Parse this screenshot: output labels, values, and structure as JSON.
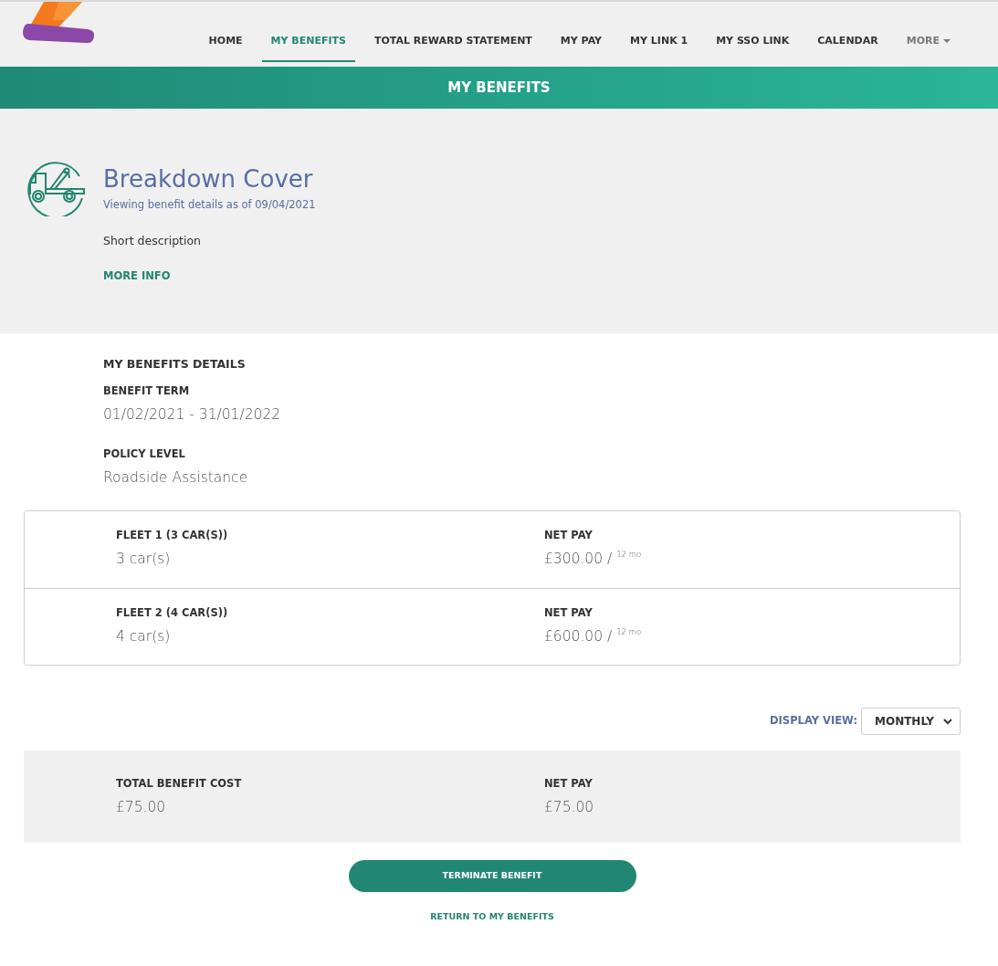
{
  "header": {
    "nav": [
      {
        "label": "HOME",
        "selected": false,
        "kind": "link"
      },
      {
        "label": "MY BENEFITS",
        "selected": true,
        "kind": "link"
      },
      {
        "label": "TOTAL REWARD STATEMENT",
        "selected": false,
        "kind": "link"
      },
      {
        "label": "MY PAY",
        "selected": false,
        "kind": "link"
      },
      {
        "label": "MY LINK 1",
        "selected": false,
        "kind": "link"
      },
      {
        "label": "MY SSO LINK",
        "selected": false,
        "kind": "link"
      },
      {
        "label": "CALENDAR",
        "selected": false,
        "kind": "link"
      },
      {
        "label": "MORE",
        "selected": false,
        "kind": "dropdown"
      }
    ]
  },
  "banner": {
    "title": "MY BENEFITS"
  },
  "benefit": {
    "title": "Breakdown Cover",
    "subtitle": "Viewing benefit details as of 09/04/2021",
    "description": "Short description",
    "more_info": "MORE INFO"
  },
  "details": {
    "heading": "MY BENEFITS DETAILS",
    "fields": [
      {
        "label": "BENEFIT TERM",
        "value": "01/02/2021 - 31/01/2022"
      },
      {
        "label": "POLICY LEVEL",
        "value": "Roadside Assistance"
      }
    ]
  },
  "fleets": [
    {
      "label": "FLEET 1 (3 CAR(S))",
      "value": "3 car(s)",
      "pay_label": "NET PAY",
      "pay": "£300.00 / $^{12 mo}$"
    },
    {
      "label": "FLEET 2 (4 CAR(S))",
      "value": "4 car(s)",
      "pay_label": "NET PAY",
      "pay": "£600.00 / $^{12 mo}$"
    }
  ],
  "display_view": {
    "label": "DISPLAY VIEW:",
    "value": "MONTHLY"
  },
  "totals": [
    {
      "label": "TOTAL BENEFIT COST",
      "value": "£75.00"
    },
    {
      "label": "NET PAY",
      "value": "£75.00"
    }
  ],
  "actions": {
    "terminate": "TERMINATE BENEFIT",
    "return": "RETURN TO MY BENEFITS"
  }
}
